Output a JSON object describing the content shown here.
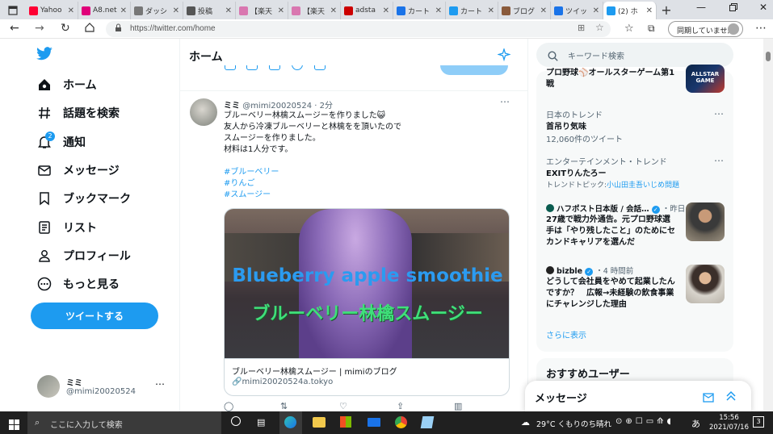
{
  "browser": {
    "tabs": [
      {
        "label": "Yahoo",
        "color": "#ff0033"
      },
      {
        "label": "A8.net",
        "color": "#e0007a"
      },
      {
        "label": "ダッシ",
        "color": "#777777"
      },
      {
        "label": "投稿",
        "color": "#555555"
      },
      {
        "label": "【楽天",
        "color": "#d977b0"
      },
      {
        "label": "【楽天",
        "color": "#d977b0"
      },
      {
        "label": "adsta",
        "color": "#cc0000"
      },
      {
        "label": "カート",
        "color": "#1a73e8"
      },
      {
        "label": "カート",
        "color": "#1d9bf0"
      },
      {
        "label": "ブログ",
        "color": "#8a5a3b"
      },
      {
        "label": "ツイッ",
        "color": "#1a73e8"
      },
      {
        "label": "(2) ホ",
        "color": "#1d9bf0"
      }
    ],
    "url": "https://twitter.com/home",
    "sync_label": "同期していません"
  },
  "nav": {
    "items": [
      {
        "label": "ホーム",
        "icon": "home-icon"
      },
      {
        "label": "話題を検索",
        "icon": "hashtag-icon"
      },
      {
        "label": "通知",
        "icon": "bell-icon"
      },
      {
        "label": "メッセージ",
        "icon": "mail-icon"
      },
      {
        "label": "ブックマーク",
        "icon": "bookmark-icon"
      },
      {
        "label": "リスト",
        "icon": "list-icon"
      },
      {
        "label": "プロフィール",
        "icon": "person-icon"
      },
      {
        "label": "もっと見る",
        "icon": "more-circle-icon"
      }
    ],
    "notif_badge": "2",
    "tweet_button": "ツイートする",
    "profile": {
      "name": "ミミ",
      "handle": "@mimi20020524"
    }
  },
  "main": {
    "title": "ホーム",
    "tweet": {
      "name": "ミミ",
      "handle": "@mimi20020524",
      "time": "2分",
      "lines": [
        "ブルーベリー林檎スムージーを作りました😺",
        "友人から冷凍ブルーベリーと林檎をを頂いたので",
        "スムージーを作りました。",
        "材料は1人分です。"
      ],
      "hashtags": [
        "#ブルーベリー",
        "#りんご",
        "#スムージー"
      ],
      "image_en": "Blueberry apple smoothie",
      "image_jp": "ブルーベリー林檎スムージー",
      "card_title": "ブルーベリー林檎スムージー | mimiのブログ",
      "card_domain": "mimi20020524a.tokyo"
    }
  },
  "sidebar": {
    "search_placeholder": "キーワード検索",
    "trends": [
      {
        "title": "プロ野球⚾オールスターゲーム第1戦",
        "has_image": true
      },
      {
        "category": "日本のトレンド",
        "title": "首吊り気味",
        "count": "12,060件のツイート"
      },
      {
        "category": "エンターテインメント・トレンド",
        "title": "EXITりんたろー",
        "topic_prefix": "トレンドトピック:",
        "topic": "小山田圭吾いじめ問題"
      },
      {
        "source": "ハフポスト日本版 / 会話…",
        "time": "・昨日",
        "title": "27歳で戦力外通告。元プロ野球選手は「やり残したこと」のためにセカンドキャリアを選んだ"
      },
      {
        "source": "bizble",
        "time": "・4 時間前",
        "title": "どうして会社員をやめて起業したんですか？　広報→未経験の飲食事業にチャレンジした理由"
      }
    ],
    "show_more": "さらに表示",
    "follow_title": "おすすめユーザー",
    "messages_title": "メッセージ",
    "colors": {
      "accent": "#1d9bf0"
    }
  },
  "taskbar": {
    "search_placeholder": "ここに入力して検索",
    "weather": "29°C くもりのち晴れ",
    "ime": "あ",
    "time": "15:56",
    "date": "2021/07/16",
    "notif_count": "3"
  }
}
